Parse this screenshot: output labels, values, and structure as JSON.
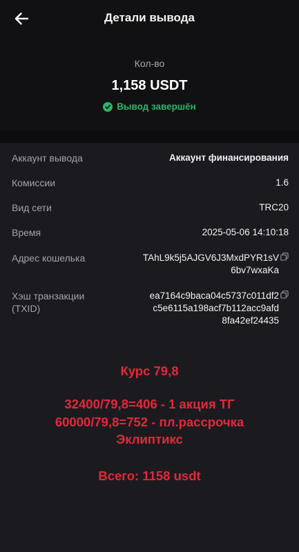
{
  "header": {
    "title": "Детали вывода",
    "back_icon": "arrow-left-icon"
  },
  "summary": {
    "amount_label": "Кол-во",
    "amount": "1,158 USDT",
    "status": "Вывод завершён",
    "status_color": "#2fb36b"
  },
  "details": {
    "account_label": "Аккаунт вывода",
    "account_value": "Аккаунт финансирования",
    "fee_label": "Комиссии",
    "fee_value": "1.6",
    "network_label": "Вид сети",
    "network_value": "TRC20",
    "time_label": "Время",
    "time_value": "2025-05-06 14:10:18",
    "address_label": "Адрес кошелька",
    "address_line1": "TAhL9k5j5AJGV6J3MxdPYR1sV",
    "address_line2": "6bv7wxaKa",
    "txid_label_1": "Хэш транзакции",
    "txid_label_2": "(TXID)",
    "txid_line1": "ea7164c9baca04c5737c011df2",
    "txid_line2": "c5e6115a198acf7b112acc9afd",
    "txid_line3": "8fa42ef24435"
  },
  "annotation": {
    "color": "#e5273a",
    "rate": "Курс 79,8",
    "calc1": "32400/79,8=406 - 1 акция ТГ",
    "calc2": "60000/79,8=752 - пл.рассрочка",
    "calc2_cont": "Эклиптикс",
    "total": "Всего: 1158 usdt"
  }
}
